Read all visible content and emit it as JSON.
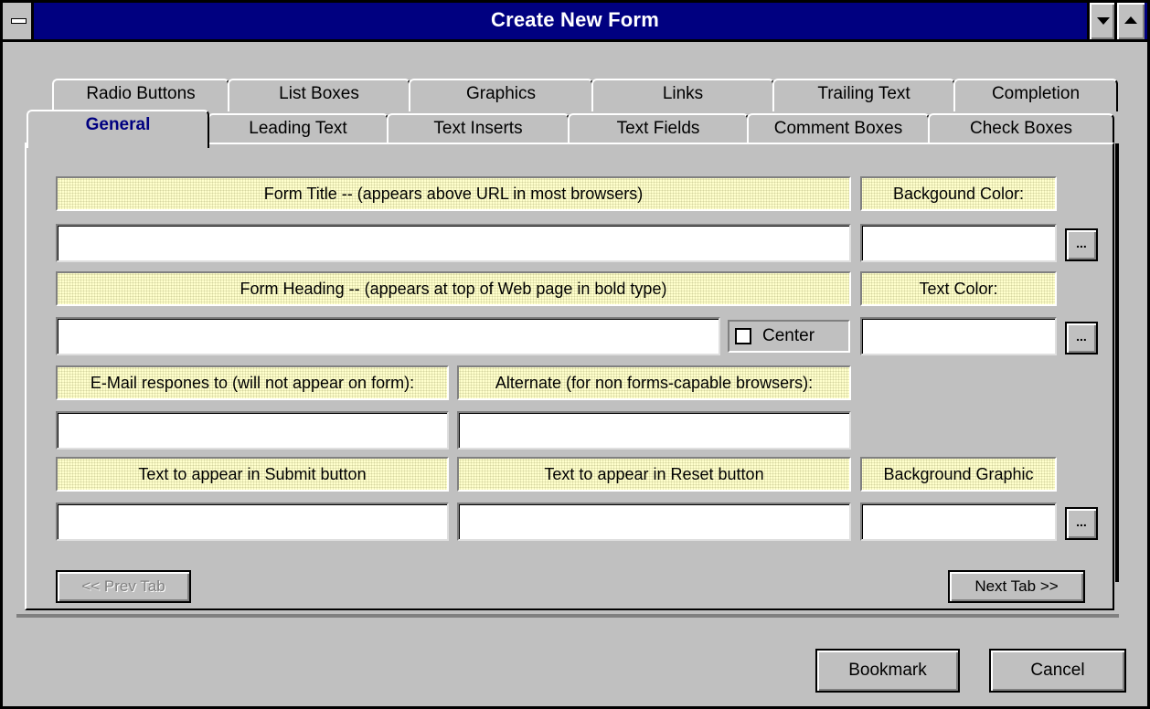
{
  "window": {
    "title": "Create New Form"
  },
  "tabs": {
    "back_row": [
      "Radio Buttons",
      "List Boxes",
      "Graphics",
      "Links",
      "Trailing Text",
      "Completion"
    ],
    "front_row": [
      "General",
      "Leading Text",
      "Text Inserts",
      "Text Fields",
      "Comment Boxes",
      "Check Boxes"
    ],
    "active": "General"
  },
  "general": {
    "form_title_label": "Form Title -- (appears above URL in most browsers)",
    "form_title_value": "",
    "bg_color_label": "Backgound Color:",
    "bg_color_value": "",
    "form_heading_label": "Form Heading -- (appears at top of Web page in bold type)",
    "form_heading_value": "",
    "center_label": "Center",
    "center_checked": false,
    "text_color_label": "Text Color:",
    "text_color_value": "",
    "email_label": "E-Mail respones to (will not appear on form):",
    "email_value": "",
    "alternate_label": "Alternate (for non forms-capable browsers):",
    "alternate_value": "",
    "submit_label": "Text to appear in Submit button",
    "submit_value": "",
    "reset_label": "Text to appear in Reset button",
    "reset_value": "",
    "bg_graphic_label": "Background Graphic",
    "bg_graphic_value": "",
    "browse_label": "..."
  },
  "nav": {
    "prev_label": "<< Prev Tab",
    "next_label": "Next Tab >>"
  },
  "buttons": {
    "bookmark_label": "Bookmark",
    "cancel_label": "Cancel"
  }
}
